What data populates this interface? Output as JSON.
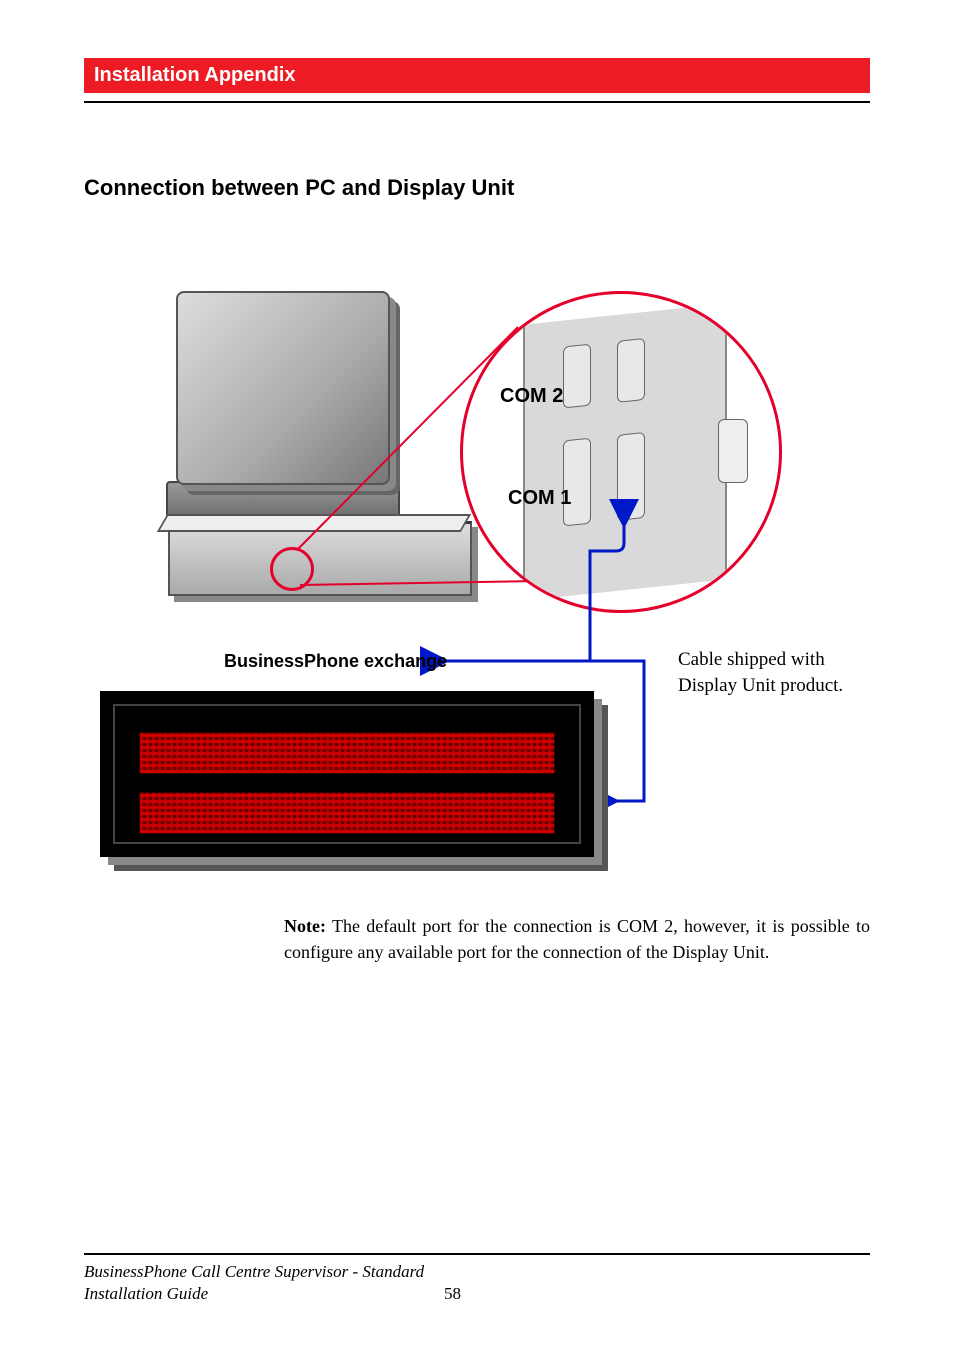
{
  "header": {
    "title": "Installation Appendix"
  },
  "section": {
    "heading": "Connection between PC and Display Unit"
  },
  "figure": {
    "com2_label": "COM 2",
    "com1_label": "COM 1",
    "bp_label": "BusinessPhone exchange",
    "cable_text": "Cable shipped with Display Unit product."
  },
  "note": {
    "prefix": "Note:",
    "body": "The default port for the connection is COM 2, however, it is possible to configure any available port for the connection of the Display Unit."
  },
  "footer": {
    "line1": "BusinessPhone Call Centre Supervisor - Standard",
    "line2": "Installation Guide",
    "page": "58"
  }
}
